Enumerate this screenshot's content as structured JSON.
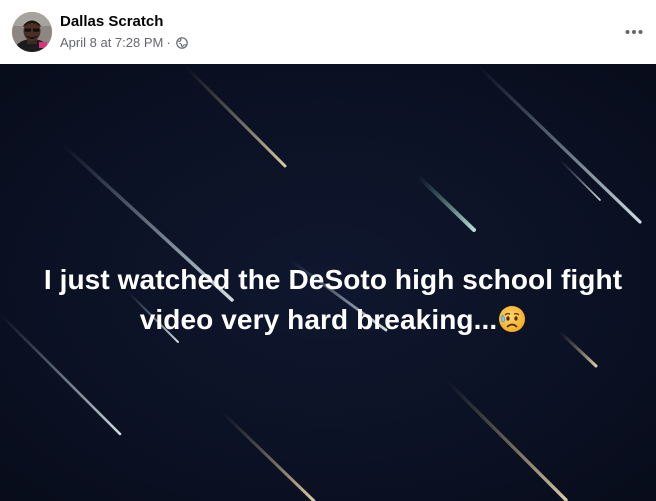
{
  "post": {
    "author": {
      "name": "Dallas Scratch",
      "avatar_icon": "profile-photo"
    },
    "meta": {
      "timestamp": "April 8 at 7:28 PM",
      "separator": "·",
      "privacy_icon": "globe-icon"
    },
    "more_icon": "more-options-icon",
    "status": {
      "text": "I just watched the DeSoto high school fight video very hard breaking...",
      "emoji": "sad-sweat-face-emoji",
      "background": "#0c1227",
      "text_color": "#ffffff"
    }
  }
}
